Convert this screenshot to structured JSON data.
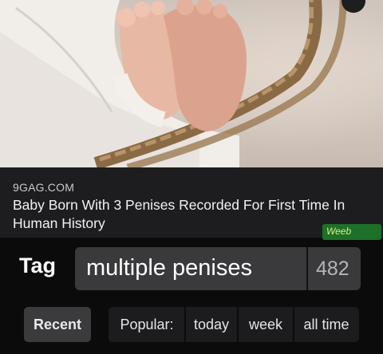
{
  "article": {
    "source": "9GAG.COM",
    "headline": "Baby Born With 3 Penises Recorded For First Time In Human History",
    "watermark": "Weeb"
  },
  "tag_header": {
    "label": "Tag",
    "tag_name": "multiple penises",
    "count": "482"
  },
  "filters": {
    "recent": "Recent",
    "popular_label": "Popular:",
    "today": "today",
    "week": "week",
    "all_time": "all time"
  },
  "icons": [
    "overflow-menu-icon"
  ],
  "colors": {
    "background": "#0b0b0b",
    "card": "#1d1d1f",
    "pill": "#3a3a3c",
    "watermark": "#1e6f2a"
  }
}
